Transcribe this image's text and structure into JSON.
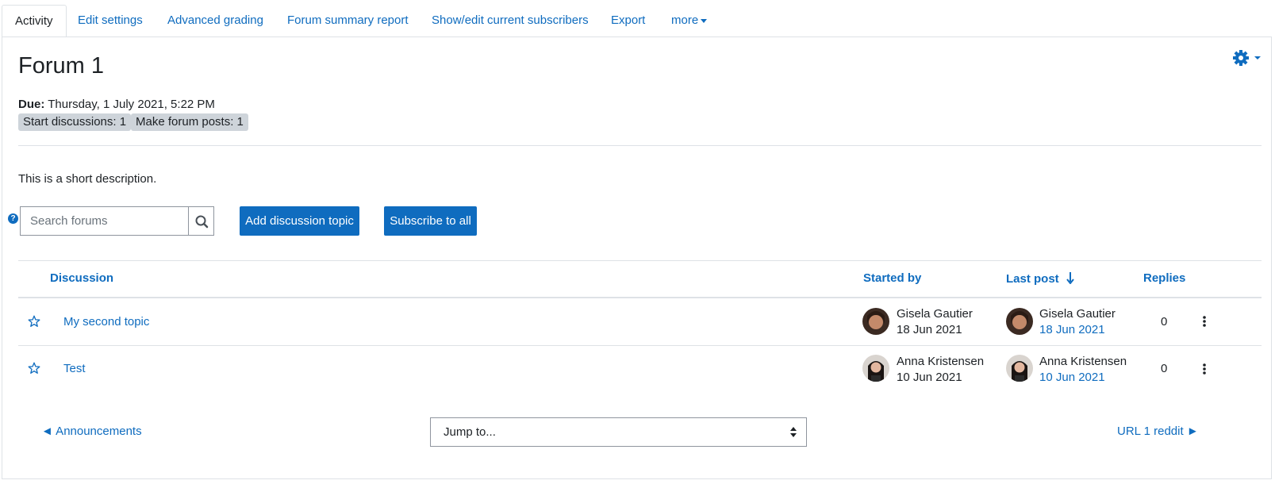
{
  "tabs": {
    "active": "Activity",
    "items": [
      "Edit settings",
      "Advanced grading",
      "Forum summary report",
      "Show/edit current subscribers",
      "Export",
      "more"
    ]
  },
  "forum": {
    "title": "Forum 1",
    "due_label": "Due:",
    "due_value": "Thursday, 1 July 2021, 5:22 PM",
    "badges": [
      "Start discussions: 1",
      "Make forum posts: 1"
    ],
    "description": "This is a short description."
  },
  "search": {
    "placeholder": "Search forums",
    "icon": "search-icon",
    "help_icon": "question-icon"
  },
  "buttons": {
    "add_topic": "Add discussion topic",
    "subscribe_all": "Subscribe to all"
  },
  "table": {
    "headers": {
      "discussion": "Discussion",
      "started_by": "Started by",
      "last_post": "Last post",
      "replies": "Replies"
    },
    "rows": [
      {
        "topic": "My second topic",
        "started_name": "Gisela Gautier",
        "started_date": "18 Jun 2021",
        "last_name": "Gisela Gautier",
        "last_date": "18 Jun 2021",
        "replies": "0"
      },
      {
        "topic": "Test",
        "started_name": "Anna Kristensen",
        "started_date": "10 Jun 2021",
        "last_name": "Anna Kristensen",
        "last_date": "10 Jun 2021",
        "replies": "0"
      }
    ]
  },
  "nav": {
    "prev": "◄ Announcements",
    "jump": "Jump to...",
    "next": "URL 1 reddit ►"
  },
  "colors": {
    "link": "#0f6cbf",
    "badge": "#ced4da",
    "border": "#dee2e6"
  }
}
